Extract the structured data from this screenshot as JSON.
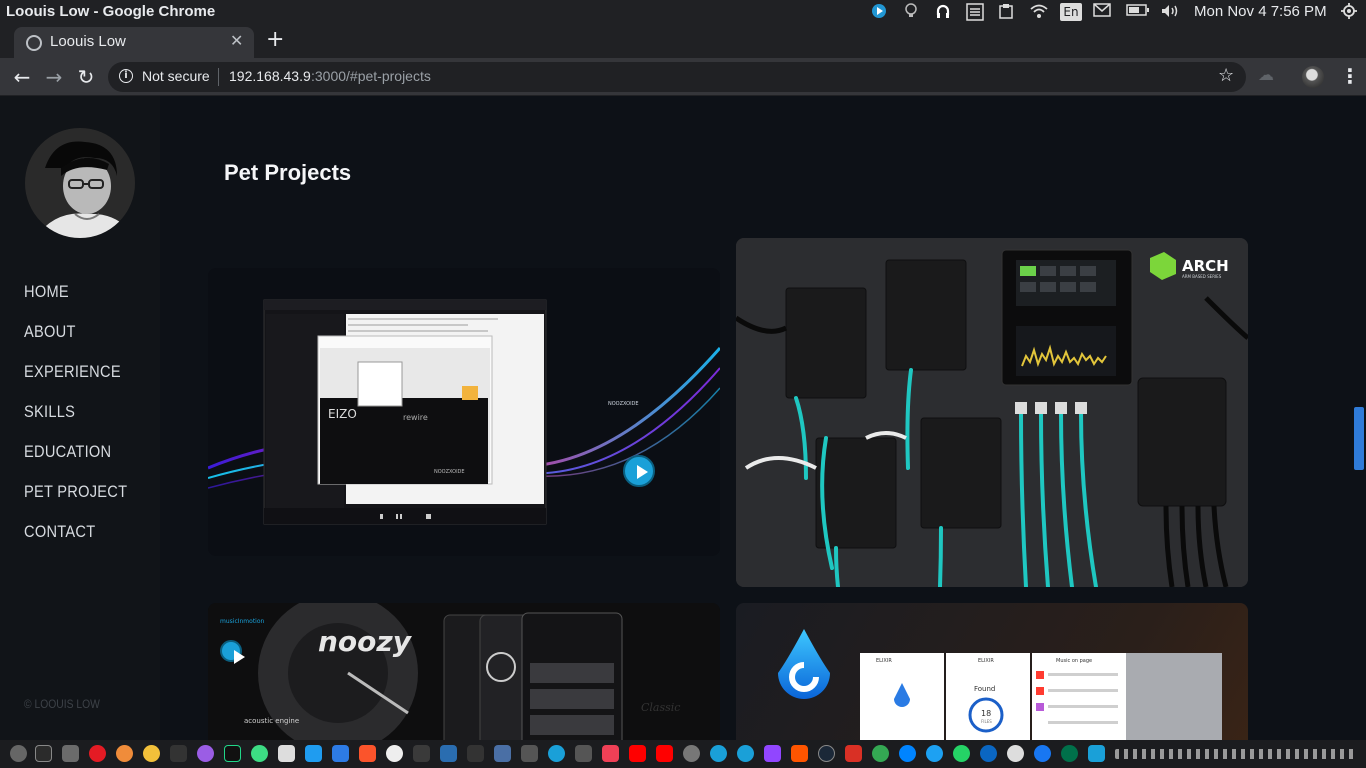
{
  "os": {
    "window_title": "Loouis Low - Google Chrome",
    "input_indicator": "En",
    "clock": "Mon Nov  4  7:56 PM"
  },
  "browser": {
    "tab_title": "Loouis Low",
    "security_label": "Not secure",
    "url_host": "192.168.43.9",
    "url_path": ":3000/#pet-projects"
  },
  "sidebar": {
    "nav": [
      {
        "label": "HOME"
      },
      {
        "label": "ABOUT"
      },
      {
        "label": "EXPERIENCE"
      },
      {
        "label": "SKILLS"
      },
      {
        "label": "EDUCATION"
      },
      {
        "label": "PET PROJECT"
      },
      {
        "label": "CONTACT"
      }
    ],
    "copyright": "© LOOUIS LOW"
  },
  "main": {
    "section_title": "Pet Projects",
    "projects": [
      {
        "brand": "NOOZXOIDE",
        "caption": "rewire"
      },
      {
        "brand": "ARCH",
        "tagline": "ARM BASED SERIES"
      },
      {
        "brand": "noozy",
        "header": "musicInmotion",
        "footer": "acoustic engine",
        "side": "Classic"
      },
      {
        "brand": "ELIXIR",
        "found_label": "Found",
        "found_count": "18",
        "found_unit": "FILES",
        "list_header": "Music on page"
      }
    ]
  },
  "colors": {
    "page_bg": "#0d1117",
    "sidebar_bg": "#111418",
    "accent": "#1aa0d8",
    "scroll_thumb": "#2f7bd8",
    "cable": "#1fc7c1"
  },
  "icons": {
    "tray": [
      "play-tray-icon",
      "bulb-icon",
      "headphones-icon",
      "list-icon",
      "clipboard-icon",
      "wifi-icon",
      "keyboard-layout-icon",
      "mail-icon",
      "battery-icon",
      "volume-icon",
      "power-icon"
    ],
    "dock": [
      "settings-icon",
      "terminal-icon",
      "files-icon",
      "opera-icon",
      "firefox-icon",
      "chrome-icon",
      "headphones-icon",
      "podcast-icon",
      "pycharm-icon",
      "android-icon",
      "editor-icon",
      "vscode-icon",
      "box-icon",
      "brave-icon",
      "github-icon",
      "home-icon",
      "visual-studio-icon",
      "media-icon",
      "notes-icon",
      "pocket-icon",
      "youtube-icon",
      "camera-icon",
      "play-icon",
      "twitch-icon",
      "soundcloud-icon",
      "steam-icon",
      "mail-icon",
      "chat-icon",
      "messenger-icon",
      "twitter-icon",
      "whatsapp-icon",
      "linkedin-icon",
      "wordpress-icon",
      "facebook-icon",
      "starbucks-icon",
      "news-icon",
      "more-icon"
    ]
  }
}
